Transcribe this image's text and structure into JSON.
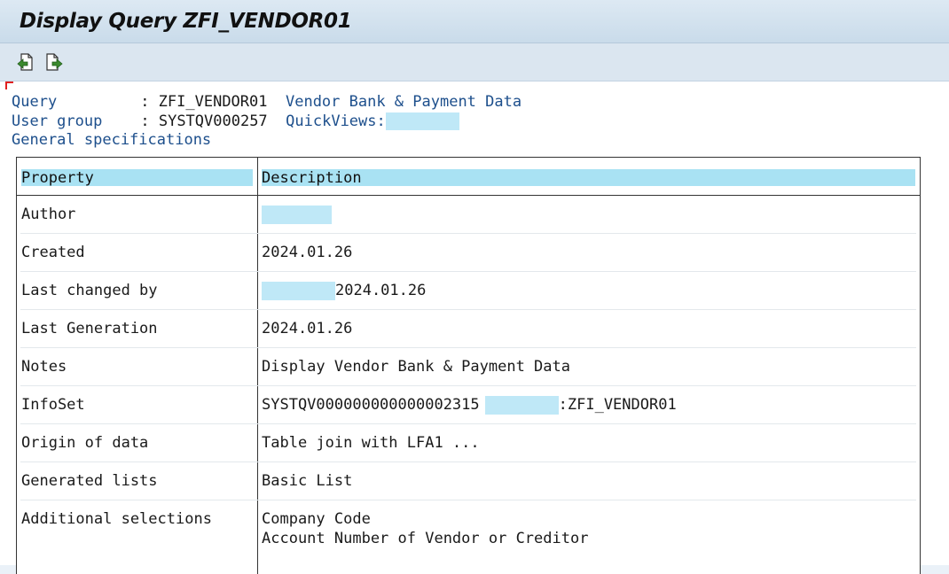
{
  "window": {
    "title": "Display Query ZFI_VENDOR01"
  },
  "toolbar": {
    "buttons": [
      {
        "icon": "previous-object-icon"
      },
      {
        "icon": "next-object-icon"
      }
    ]
  },
  "header": {
    "query_label": "Query",
    "query_value": "ZFI_VENDOR01",
    "query_title": "Vendor Bank & Payment Data",
    "user_group_label": "User group",
    "user_group_value": "SYSTQV000257",
    "quickviews_label": "QuickViews:",
    "section_title": "General specifications"
  },
  "table": {
    "columns": [
      "Property",
      "Description"
    ],
    "rows": [
      {
        "property": "Author",
        "description": ""
      },
      {
        "property": "Created",
        "description": "2024.01.26"
      },
      {
        "property": "Last changed by",
        "description": "2024.01.26"
      },
      {
        "property": "Last Generation",
        "description": "2024.01.26"
      },
      {
        "property": "Notes",
        "description": "Display Vendor Bank & Payment Data"
      },
      {
        "property": "InfoSet",
        "description": "SYSTQV000000000000002315",
        "description_suffix": ":ZFI_VENDOR01"
      },
      {
        "property": "Origin of data",
        "description": "Table join with LFA1 ..."
      },
      {
        "property": "Generated lists",
        "description": "Basic List"
      },
      {
        "property": "Additional selections",
        "description": "Company Code",
        "description_line2": "Account Number of Vendor or Creditor"
      }
    ]
  },
  "colors": {
    "header_text": "#1d4f8c",
    "column_header_bg": "#a9e2f3",
    "redacted_bg": "#bfe8f7"
  }
}
